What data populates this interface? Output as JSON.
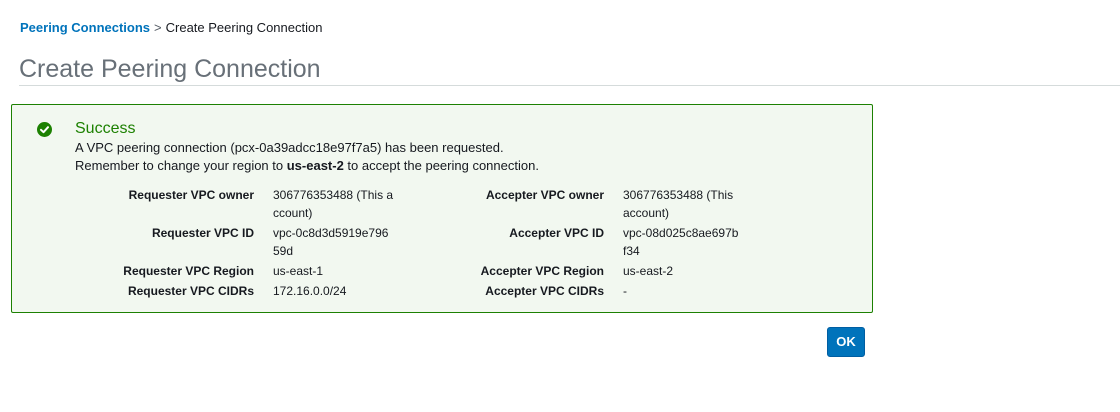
{
  "breadcrumb": {
    "parent": "Peering Connections",
    "separator": ">",
    "current": "Create Peering Connection"
  },
  "page_title": "Create Peering Connection",
  "alert": {
    "title": "Success",
    "message_line1": "A VPC peering connection (pcx-0a39adcc18e97f7a5) has been requested.",
    "message_line2_prefix": "Remember to change your region to ",
    "message_line2_region": "us-east-2",
    "message_line2_suffix": " to accept the peering connection.",
    "status_color": "#1d8102",
    "icon": "check-circle-icon"
  },
  "details": {
    "requester": {
      "owner_label": "Requester VPC owner",
      "owner_value": "306776353488 (This account)",
      "id_label": "Requester VPC ID",
      "id_value": "vpc-0c8d3d5919e79659d",
      "region_label": "Requester VPC Region",
      "region_value": "us-east-1",
      "cidrs_label": "Requester VPC CIDRs",
      "cidrs_value": "172.16.0.0/24"
    },
    "accepter": {
      "owner_label": "Accepter VPC owner",
      "owner_value": "306776353488 (This account)",
      "id_label": "Accepter VPC ID",
      "id_value": "vpc-08d025c8ae697bf34",
      "region_label": "Accepter VPC Region",
      "region_value": "us-east-2",
      "cidrs_label": "Accepter VPC CIDRs",
      "cidrs_value": "-"
    }
  },
  "ok_button": {
    "label": "OK",
    "color": "#0073bb"
  }
}
